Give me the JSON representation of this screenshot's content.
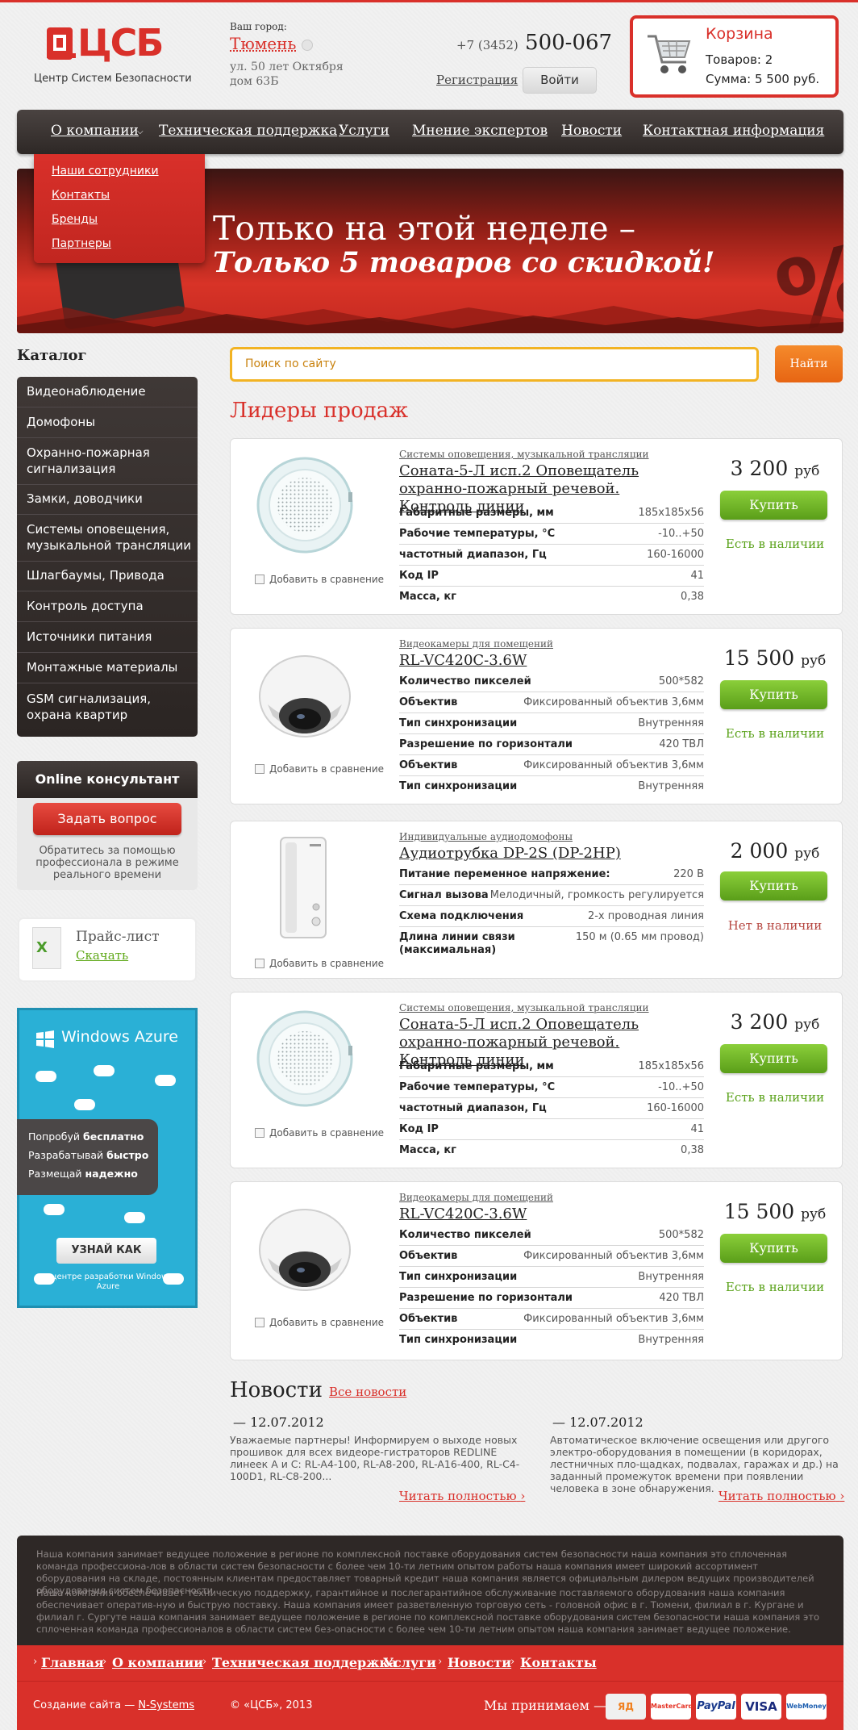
{
  "header": {
    "logo_text": "ЦСБ",
    "logo_subtitle": "Центр Систем Безопасности",
    "city_caption": "Ваш город:",
    "city": "Тюмень",
    "address": "ул. 50 лет Октября дом 63Б",
    "phone_code": "+7 (3452)",
    "phone_number": "500-067",
    "register": "Регистрация",
    "login": "Войти"
  },
  "cart": {
    "title": "Корзина",
    "items": "Товаров: 2",
    "sum": "Сумма: 5 500 руб."
  },
  "menu": {
    "items": [
      "О компании",
      "Техническая поддержка",
      "Услуги",
      "Мнение экспертов",
      "Новости",
      "Контактная информация"
    ],
    "dropdown": [
      "Наши сотрудники",
      "Контакты",
      "Бренды",
      "Партнеры"
    ]
  },
  "banner": {
    "line1": "Только на этой неделе –",
    "line2": "Только 5 товаров со скидкой!"
  },
  "catalog": {
    "title": "Каталог",
    "items": [
      "Видеонаблюдение",
      "Домофоны",
      "Охранно-пожарная сигнализация",
      "Замки, доводчики",
      "Системы оповещения, музыкальной трансляции",
      "Шлагбаумы, Привода",
      "Контроль доступа",
      "Источники питания",
      "Монтажные материалы",
      "GSM сигнализация, охрана квартир"
    ]
  },
  "online": {
    "title": "Online консультант",
    "button": "Задать вопрос",
    "note": "Обратитесь за помощью профессионала в режиме реального времени"
  },
  "pricelist": {
    "title": "Прайс-лист",
    "link": "Скачать"
  },
  "azure": {
    "title": "Windows Azure",
    "line1a": "Попробуй ",
    "line1b": "бесплатно",
    "line2a": "Разрабатывай ",
    "line2b": "быстро",
    "line3a": "Размещай ",
    "line3b": "надежно",
    "button": "УЗНАЙ КАК",
    "note": "в центре разработки Windows Azure"
  },
  "search": {
    "placeholder": "Поиск по сайту",
    "button": "Найти"
  },
  "leaders_title": "Лидеры продаж",
  "compare_label": "Добавить в сравнение",
  "buy_label": "Купить",
  "currency": "руб",
  "products": [
    {
      "category": "Системы оповещения, музыкальной трансляции",
      "name": "Соната-5-Л исп.2 Оповещатель охранно-пожарный речевой. Контроль линии",
      "price": "3 200",
      "stock": "Есть в наличии",
      "specs": [
        [
          "Габаритные размеры, мм",
          "185x185x56"
        ],
        [
          "Рабочие температуры, °С",
          "-10..+50"
        ],
        [
          "частотный диапазон, Гц",
          "160-16000"
        ],
        [
          "Код IP",
          "41"
        ],
        [
          "Масса, кг",
          "0,38"
        ]
      ]
    },
    {
      "category": "Видеокамеры для помещений",
      "name": "RL-VC420C-3.6W",
      "price": "15 500",
      "stock": "Есть в наличии",
      "specs": [
        [
          "Количество пикселей",
          "500*582"
        ],
        [
          "Объектив",
          "Фиксированный объектив 3,6мм"
        ],
        [
          "Тип синхронизации",
          "Внутренняя"
        ],
        [
          "Разрешение по горизонтали",
          "420 ТВЛ"
        ],
        [
          "Объектив",
          "Фиксированный объектив 3,6мм"
        ],
        [
          "Тип синхронизации",
          "Внутренняя"
        ]
      ]
    },
    {
      "category": "Индивидуальные аудиодомофоны",
      "name": "Аудиотрубка DP-2S (DP-2HP)",
      "price": "2 000",
      "stock": "Нет в наличии",
      "specs": [
        [
          "Питание переменное напряжение:",
          "220 В"
        ],
        [
          "Сигнал вызова",
          "Мелодичный, громкость регулируется"
        ],
        [
          "Схема подключения",
          "2-х проводная линия"
        ],
        [
          "Длина линии связи (максимальная)",
          "150 м (0.65 мм провод)"
        ]
      ]
    },
    {
      "category": "Системы оповещения, музыкальной трансляции",
      "name": "Соната-5-Л исп.2 Оповещатель охранно-пожарный речевой. Контроль линии",
      "price": "3 200",
      "stock": "Есть в наличии",
      "specs": [
        [
          "Габаритные размеры, мм",
          "185x185x56"
        ],
        [
          "Рабочие температуры, °С",
          "-10..+50"
        ],
        [
          "частотный диапазон, Гц",
          "160-16000"
        ],
        [
          "Код IP",
          "41"
        ],
        [
          "Масса, кг",
          "0,38"
        ]
      ]
    },
    {
      "category": "Видеокамеры для помещений",
      "name": "RL-VC420C-3.6W",
      "price": "15 500",
      "stock": "Есть в наличии",
      "specs": [
        [
          "Количество пикселей",
          "500*582"
        ],
        [
          "Объектив",
          "Фиксированный объектив 3,6мм"
        ],
        [
          "Тип синхронизации",
          "Внутренняя"
        ],
        [
          "Разрешение по горизонтали",
          "420 ТВЛ"
        ],
        [
          "Объектив",
          "Фиксированный объектив 3,6мм"
        ],
        [
          "Тип синхронизации",
          "Внутренняя"
        ]
      ]
    }
  ],
  "news": {
    "title": "Новости",
    "all": "Все новости",
    "more": "Читать полностью",
    "items": [
      {
        "date": "12.07.2012",
        "text": "Уважаемые партнеры! Информируем о выходе новых прошивок для всех видеоре-гистраторов REDLINE линеек А и С: RL-A4-100, RL-A8-200, RL-A16-400, RL-C4-100D1, RL-C8-200..."
      },
      {
        "date": "12.07.2012",
        "text": "Автоматическое включение освещения или другого электро-оборудования в помещении (в коридорах, лестничных пло-щадках, подвалах, гаражах и др.) на заданный промежуток времени при появлении человека в зоне обнаружения."
      }
    ]
  },
  "footer": {
    "text1": "Наша компания занимает ведущее положение в регионе по комплексной поставке оборудования систем безопасности наша компания это сплоченная команда профессиона-лов в области систем безопасности с более чем 10-ти летним опытом работы наша компания имеет широкий ассортимент оборудования на складе, постоянным клиентам предоставляет товарный кредит наша компания является официальным дилером ведущих производителей оборудования систем безопасности",
    "text2": "Наша компания обеспечивает техническую поддержку, гарантийное и послегарантийное обслуживание поставляемого оборудования наша компания обеспечивает оператив-ную и быструю поставку. Наша компания имеет разветвленную торговую сеть - головной офис в г. Тюмени, филиал в г. Кургане и филиал г. Сургуте наша компания занимает ведущее положение в регионе по комплексной поставке оборудования систем безопасности наша компания это сплоченная команда профессионалов в области систем без-опасности с более чем 10-ти летним опытом наша компания занимает ведущее положение.",
    "nav": [
      "Главная",
      "О компании",
      "Техническая поддержка",
      "Услуги",
      "Новости",
      "Контакты"
    ],
    "created_prefix": "Создание сайта —",
    "created_link": "N-Systems",
    "copyright": "© «ЦСБ», 2013",
    "we_accept": "Мы принимаем —",
    "payments": [
      "ЯД",
      "MasterCard",
      "PayPal",
      "VISA",
      "WebMoney"
    ]
  },
  "colors": {
    "brand_red": "#d9302a",
    "green_buy": "#6db224",
    "search_border": "#f2b323",
    "find_orange": "#ee7a1e"
  }
}
